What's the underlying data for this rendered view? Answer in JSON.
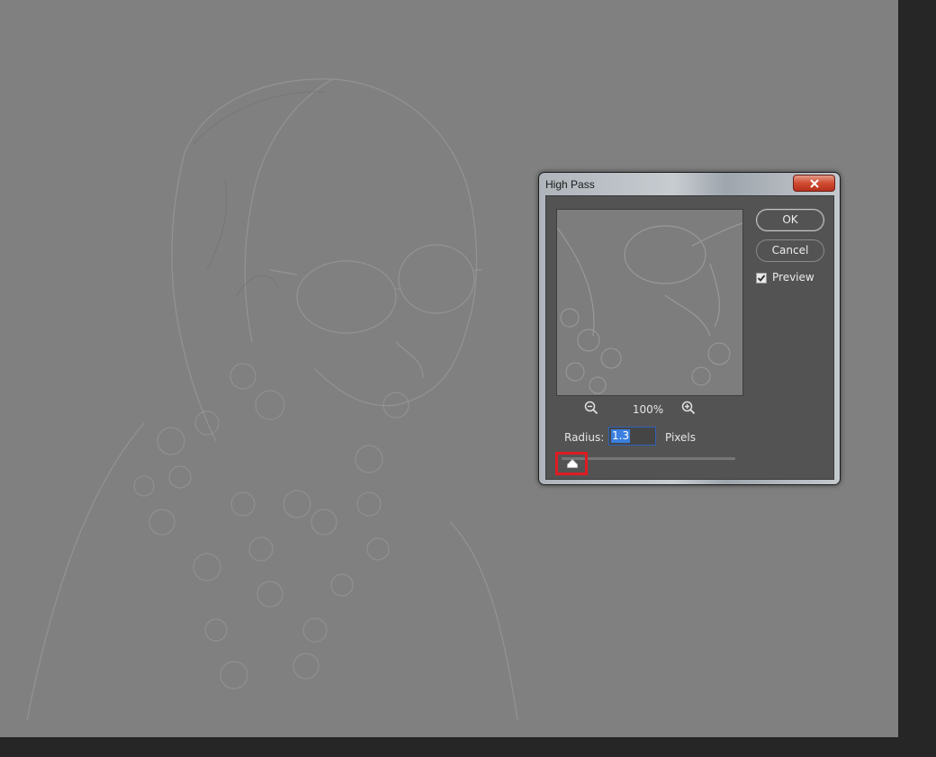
{
  "dialog": {
    "title": "High Pass",
    "ok_label": "OK",
    "cancel_label": "Cancel",
    "preview_label": "Preview",
    "preview_checked": true,
    "zoom_level": "100%",
    "radius_label": "Radius:",
    "radius_value": "1.3",
    "units_label": "Pixels",
    "radius_slider_position": 0.05
  },
  "icons": {
    "close": "close-icon",
    "zoom_out": "zoom-out-icon",
    "zoom_in": "zoom-in-icon",
    "checkmark": "checkmark-icon",
    "slider_thumb": "slider-thumb-icon"
  },
  "colors": {
    "canvas": "#808080",
    "app_background": "#282828",
    "dialog_panel": "#535353",
    "highlight_box": "#e01b22",
    "input_selection": "#3a7fe0",
    "close_button": "#cf4b31"
  }
}
